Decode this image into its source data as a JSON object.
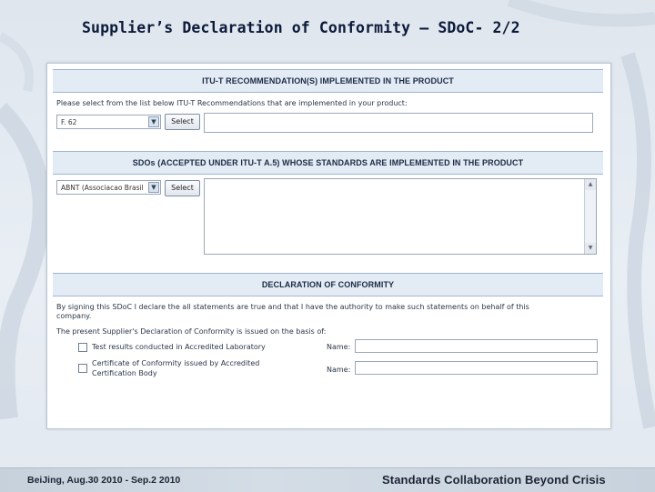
{
  "slide": {
    "title": "Supplier’s Declaration of Conformity – SDoC- 2/2"
  },
  "sec1": {
    "heading": "ITU-T RECOMMENDATION(S) IMPLEMENTED IN THE PRODUCT",
    "instruction": "Please select from the list below ITU-T Recommendations that are implemented in your product:",
    "select_value": "F. 62",
    "button": "Select"
  },
  "sec2": {
    "heading": "SDOs (ACCEPTED UNDER ITU-T A.5) WHOSE STANDARDS ARE IMPLEMENTED IN THE PRODUCT",
    "select_value": "ABNT (Associacao Brasil",
    "button": "Select"
  },
  "sec3": {
    "heading": "DECLARATION OF CONFORMITY",
    "statement_line1": "By signing this SDoC I declare the all statements are true and that I have the authority to make such statements on behalf of this",
    "statement_line2": "company.",
    "basis": "The present Supplier's Declaration of Conformity is issued on the basis of:",
    "option1": "Test results conducted in Accredited Laboratory",
    "option2_line1": "Certificate of Conformity issued by Accredited",
    "option2_line2": "Certification Body",
    "name_label1": "Name:",
    "name_label2": "Name:"
  },
  "footer": {
    "left": "BeiJing,   Aug.30 2010 - Sep.2  2010",
    "right": "Standards Collaboration Beyond Crisis"
  }
}
